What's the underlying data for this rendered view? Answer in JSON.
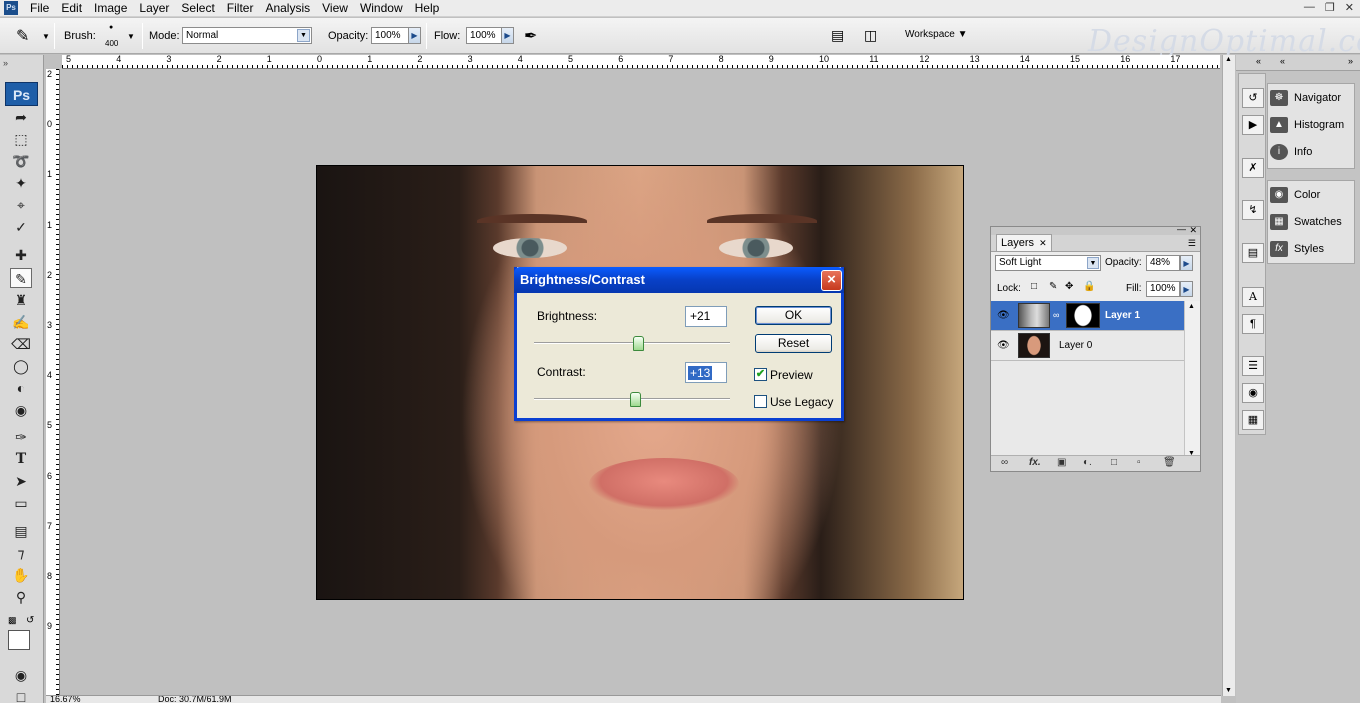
{
  "menubar": {
    "app_icon": "Ps",
    "items": [
      "File",
      "Edit",
      "Image",
      "Layer",
      "Select",
      "Filter",
      "Analysis",
      "View",
      "Window",
      "Help"
    ]
  },
  "options": {
    "brush_label": "Brush:",
    "brush_size": "400",
    "mode_label": "Mode:",
    "mode_value": "Normal",
    "opacity_label": "Opacity:",
    "opacity_value": "100%",
    "flow_label": "Flow:",
    "flow_value": "100%",
    "workspace_label": "Workspace",
    "watermark": "DesignOptimal.com"
  },
  "ruler": {
    "top_labels": [
      "5",
      "4",
      "3",
      "2",
      "1",
      "0",
      "1",
      "2",
      "3",
      "4",
      "5",
      "6",
      "7",
      "8",
      "9",
      "10",
      "11",
      "12",
      "13",
      "14",
      "15",
      "16",
      "17"
    ],
    "left_labels": [
      "2",
      "0",
      "1",
      "1",
      "2",
      "3",
      "4",
      "5",
      "6",
      "7",
      "8",
      "9"
    ]
  },
  "tools": {
    "logo": "Ps"
  },
  "dialog": {
    "title": "Brightness/Contrast",
    "brightness_label": "Brightness:",
    "brightness_value": "+21",
    "contrast_label": "Contrast:",
    "contrast_value": "+13",
    "ok_label": "OK",
    "reset_label": "Reset",
    "preview_label": "Preview",
    "preview_checked": true,
    "legacy_label": "Use Legacy",
    "legacy_checked": false,
    "brightness_slider_fraction": 0.535,
    "contrast_slider_fraction": 0.52
  },
  "layers": {
    "tab_label": "Layers",
    "blend_mode": "Soft Light",
    "opacity_label": "Opacity:",
    "opacity_value": "48%",
    "lock_label": "Lock:",
    "fill_label": "Fill:",
    "fill_value": "100%",
    "rows": [
      {
        "name": "Layer 1",
        "selected": true
      },
      {
        "name": "Layer 0",
        "selected": false
      }
    ]
  },
  "right_panels": {
    "group1": [
      "Navigator",
      "Histogram",
      "Info"
    ],
    "group2": [
      "Color",
      "Swatches",
      "Styles"
    ]
  },
  "status": {
    "zoom": "16.67%",
    "doc": "Doc: 30.7M/61.9M"
  },
  "colors": {
    "accent": "#0a3fd1",
    "selection": "#3a6fc4"
  }
}
